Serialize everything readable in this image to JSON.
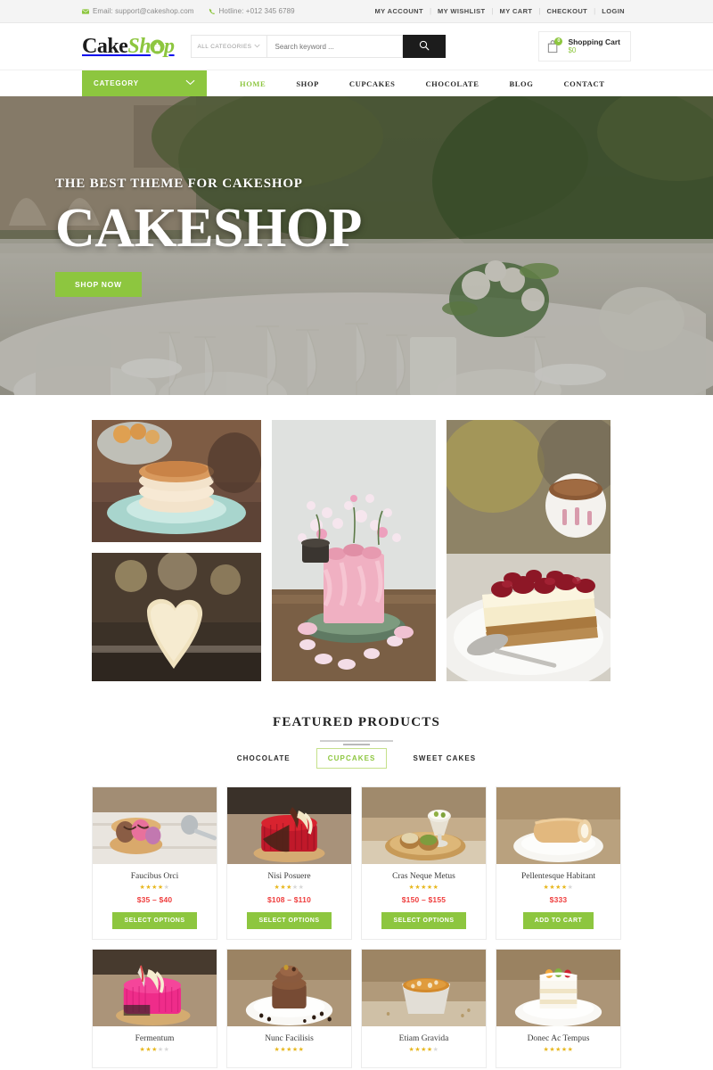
{
  "topbar": {
    "email_label": "Email: support@cakeshop.com",
    "hotline_label": "Hotline: +012 345 6789",
    "email_icon": "envelope-icon",
    "phone_icon": "phone-icon",
    "links": [
      {
        "label": "MY ACCOUNT"
      },
      {
        "label": "MY WISHLIST"
      },
      {
        "label": "MY CART"
      },
      {
        "label": "CHECKOUT"
      },
      {
        "label": "LOGIN"
      }
    ],
    "separator": "|"
  },
  "header": {
    "logo_part1": "Cake",
    "logo_part2": "Sh",
    "logo_part3": "p",
    "logo_icon": "cupcake-icon",
    "category_select_value": "ALL CATEGORIES",
    "chevron_icon": "chevron-down-icon",
    "search_placeholder": "Search keyword ...",
    "search_value": "",
    "search_icon": "search-icon",
    "cart_icon": "shopping-bag-icon",
    "cart_count": "0",
    "cart_title": "Shopping Cart",
    "cart_total": "$0"
  },
  "nav": {
    "category_label": "CATEGORY",
    "category_chevron": "chevron-down-icon",
    "items": [
      {
        "label": "HOME",
        "active": true
      },
      {
        "label": "SHOP",
        "active": false
      },
      {
        "label": "CUPCAKES",
        "active": false
      },
      {
        "label": "CHOCOLATE",
        "active": false
      },
      {
        "label": "BLOG",
        "active": false
      },
      {
        "label": "CONTACT",
        "active": false
      }
    ]
  },
  "hero": {
    "subtitle": "THE BEST THEME FOR CAKESHOP",
    "title": "CAKESHOP",
    "button_label": "SHOP NOW"
  },
  "gallery": {
    "images": [
      {
        "name": "pancake-stack-photo"
      },
      {
        "name": "heart-cookie-photo"
      },
      {
        "name": "pink-floral-cake-photo"
      },
      {
        "name": "cherry-cheesecake-slice-photo"
      }
    ]
  },
  "featured": {
    "title": "FEATURED PRODUCTS",
    "tabs": [
      {
        "label": "CHOCOLATE",
        "active": false
      },
      {
        "label": "CUPCAKES",
        "active": true
      },
      {
        "label": "SWEET CAKES",
        "active": false
      }
    ],
    "products": [
      {
        "name": "Faucibus Orci",
        "rating": 4,
        "price": "$35 – $40",
        "button": "SELECT OPTIONS",
        "image": "ice-cream-macaron-photo"
      },
      {
        "name": "Nisi Posuere",
        "rating": 3,
        "price": "$108 – $110",
        "button": "SELECT OPTIONS",
        "image": "red-glazed-cake-photo"
      },
      {
        "name": "Cras Neque Metus",
        "rating": 5,
        "price": "$150 – $155",
        "button": "SELECT OPTIONS",
        "image": "dessert-tray-photo"
      },
      {
        "name": "Pellentesque Habitant",
        "rating": 4,
        "price": "$333",
        "button": "ADD TO CART",
        "image": "swiss-roll-photo"
      },
      {
        "name": "Fermentum",
        "rating": 3,
        "price": "",
        "button": "",
        "image": "pink-glazed-cake-photo"
      },
      {
        "name": "Nunc Facilisis",
        "rating": 5,
        "price": "",
        "button": "",
        "image": "chocolate-cupcake-photo"
      },
      {
        "name": "Etiam Gravida",
        "rating": 4,
        "price": "",
        "button": "",
        "image": "creme-brulee-photo"
      },
      {
        "name": "Donec Ac Tempus",
        "rating": 5,
        "price": "",
        "button": "",
        "image": "fruit-layer-cake-photo"
      }
    ]
  },
  "colors": {
    "accent_green": "#8dc63f",
    "price_red": "#ef3d3d",
    "star_gold": "#e8b820",
    "dark": "#1c1c1c"
  }
}
